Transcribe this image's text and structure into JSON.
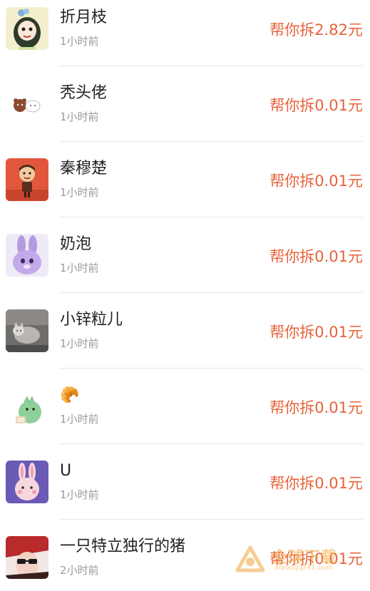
{
  "colors": {
    "amount": "#e8623a",
    "name": "#222222",
    "time": "#9a9a9a",
    "divider": "#e6e6e6"
  },
  "helpers": [
    {
      "avatar_icon": "girl-cartoon-avatar",
      "name": "折月枝",
      "time": "1小时前",
      "amount": "帮你拆2.82元"
    },
    {
      "avatar_icon": "bear-cartoon-avatar",
      "name": "秃头佬",
      "time": "1小时前",
      "amount": "帮你拆0.01元"
    },
    {
      "avatar_icon": "cartoon-boy-avatar",
      "name": "秦穆楚",
      "time": "1小时前",
      "amount": "帮你拆0.01元"
    },
    {
      "avatar_icon": "purple-bunny-avatar",
      "name": "奶泡",
      "time": "1小时前",
      "amount": "帮你拆0.01元"
    },
    {
      "avatar_icon": "cat-photo-avatar",
      "name": "小锌粒儿",
      "time": "1小时前",
      "amount": "帮你拆0.01元"
    },
    {
      "avatar_icon": "green-dinosaur-avatar",
      "name": "🥐",
      "time": "1小时前",
      "amount": "帮你拆0.01元"
    },
    {
      "avatar_icon": "pink-rabbit-avatar",
      "name": "U",
      "time": "1小时前",
      "amount": "帮你拆0.01元"
    },
    {
      "avatar_icon": "sunglasses-avatar",
      "name": "一只特立独行的猪",
      "time": "2小时前",
      "amount": "帮你拆0.01元"
    }
  ],
  "watermark": {
    "title": "全球下载",
    "url": "www.qqz41.com"
  }
}
